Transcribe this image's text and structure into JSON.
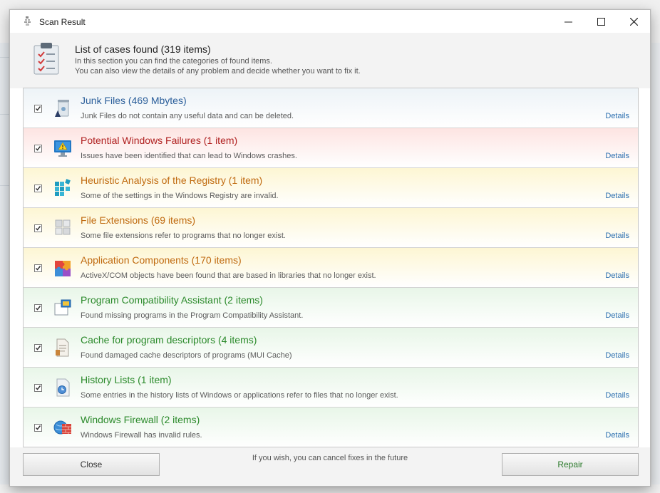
{
  "window": {
    "title": "Scan Result"
  },
  "header": {
    "title": "List of cases found (319 items)",
    "subtitle_line1": "In this section you can find the categories of found items.",
    "subtitle_line2": "You can also view the details of any problem and decide whether you want to fix it."
  },
  "colors": {
    "blue": "#2a5e9a",
    "red": "#b02121",
    "orange": "#c06a10",
    "green": "#2b8a2b",
    "link": "#2c6fb0"
  },
  "items": [
    {
      "title": "Junk Files (469 Mbytes)",
      "description": "Junk Files do not contain any useful data and can be deleted.",
      "details": "Details",
      "checked": true,
      "severity": "blue",
      "icon": "recycle-bin-icon"
    },
    {
      "title": "Potential Windows Failures (1 item)",
      "description": "Issues have been identified that can lead to Windows crashes.",
      "details": "Details",
      "checked": true,
      "severity": "red",
      "icon": "monitor-warning-icon"
    },
    {
      "title": "Heuristic Analysis of the Registry (1 item)",
      "description": "Some of the settings in the Windows Registry are invalid.",
      "details": "Details",
      "checked": true,
      "severity": "yellow",
      "icon": "registry-blocks-icon"
    },
    {
      "title": "File Extensions (69 items)",
      "description": "Some file extensions refer to programs that no longer exist.",
      "details": "Details",
      "checked": true,
      "severity": "yellow",
      "icon": "file-extension-icon"
    },
    {
      "title": "Application Components (170 items)",
      "description": "ActiveX/COM objects have been found that are based in libraries that no longer exist.",
      "details": "Details",
      "checked": true,
      "severity": "yellow",
      "icon": "puzzle-icon"
    },
    {
      "title": "Program Compatibility Assistant (2 items)",
      "description": "Found missing programs in the Program Compatibility Assistant.",
      "details": "Details",
      "checked": true,
      "severity": "green",
      "icon": "compatibility-window-icon"
    },
    {
      "title": "Cache for program descriptors (4 items)",
      "description": "Found damaged cache descriptors of programs (MUI Cache)",
      "details": "Details",
      "checked": true,
      "severity": "green",
      "icon": "document-cache-icon"
    },
    {
      "title": "History Lists (1 item)",
      "description": "Some entries in the history lists of Windows or applications refer to files that no longer exist.",
      "details": "Details",
      "checked": true,
      "severity": "green",
      "icon": "history-clock-icon"
    },
    {
      "title": "Windows Firewall (2 items)",
      "description": "Windows Firewall has invalid rules.",
      "details": "Details",
      "checked": true,
      "severity": "green",
      "icon": "firewall-globe-icon"
    }
  ],
  "footer": {
    "close_label": "Close",
    "note": "If you wish, you can cancel fixes in the future",
    "repair_label": "Repair"
  }
}
